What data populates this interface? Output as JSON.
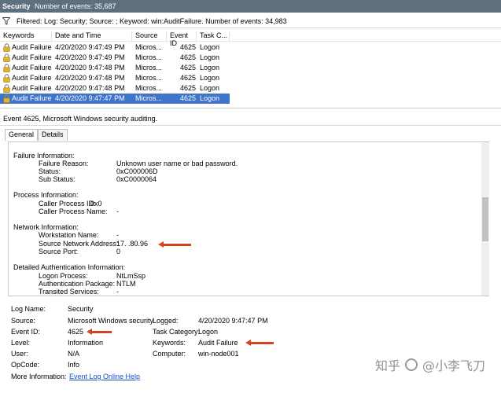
{
  "titlebar": {
    "title": "Security",
    "count_text": "Number of events: 35,687"
  },
  "filter": {
    "text": "Filtered: Log: Security; Source: ; Keyword: win:AuditFailure. Number of events: 34,983"
  },
  "grid": {
    "headers": [
      "Keywords",
      "Date and Time",
      "Source",
      "Event ID",
      "Task C..."
    ],
    "rows": [
      {
        "keyword": "Audit Failure",
        "datetime": "4/20/2020 9:47:49 PM",
        "source": "Micros...",
        "event_id": "4625",
        "task": "Logon"
      },
      {
        "keyword": "Audit Failure",
        "datetime": "4/20/2020 9:47:49 PM",
        "source": "Micros...",
        "event_id": "4625",
        "task": "Logon"
      },
      {
        "keyword": "Audit Failure",
        "datetime": "4/20/2020 9:47:48 PM",
        "source": "Micros...",
        "event_id": "4625",
        "task": "Logon"
      },
      {
        "keyword": "Audit Failure",
        "datetime": "4/20/2020 9:47:48 PM",
        "source": "Micros...",
        "event_id": "4625",
        "task": "Logon"
      },
      {
        "keyword": "Audit Failure",
        "datetime": "4/20/2020 9:47:48 PM",
        "source": "Micros...",
        "event_id": "4625",
        "task": "Logon"
      },
      {
        "keyword": "Audit Failure",
        "datetime": "4/20/2020 9:47:47 PM",
        "source": "Micros...",
        "event_id": "4625",
        "task": "Logon"
      }
    ],
    "selected_index": 5
  },
  "summary": "Event 4625, Microsoft Windows security auditing.",
  "tabs": [
    "General",
    "Details"
  ],
  "details": {
    "failure": {
      "heading": "Failure Information:",
      "reason_label": "Failure Reason:",
      "reason_value": "Unknown user name or bad password.",
      "status_label": "Status:",
      "status_value": "0xC000006D",
      "substatus_label": "Sub Status:",
      "substatus_value": "0xC0000064"
    },
    "process": {
      "heading": "Process Information:",
      "pid_label": "Caller Process ID:",
      "pid_value": "0x0",
      "pname_label": "Caller Process Name:",
      "pname_value": "-"
    },
    "network": {
      "heading": "Network Information:",
      "ws_label": "Workstation Name:",
      "ws_value": "-",
      "addr_label": "Source Network Address:",
      "addr_value": "17.  .80.96",
      "port_label": "Source Port:",
      "port_value": "0"
    },
    "auth": {
      "heading": "Detailed Authentication Information:",
      "lp_label": "Logon Process:",
      "lp_value": "NtLmSsp",
      "ap_label": "Authentication Package:",
      "ap_value": "NTLM",
      "ts_label": "Transited Services:",
      "ts_value": "-"
    }
  },
  "properties": {
    "log_name_label": "Log Name:",
    "log_name_value": "Security",
    "source_label": "Source:",
    "source_value": "Microsoft Windows security",
    "logged_label": "Logged:",
    "logged_value": "4/20/2020 9:47:47 PM",
    "event_id_label": "Event ID:",
    "event_id_value": "4625",
    "task_label": "Task Category:",
    "task_value": "Logon",
    "level_label": "Level:",
    "level_value": "Information",
    "keywords_label": "Keywords:",
    "keywords_value": "Audit Failure",
    "user_label": "User:",
    "user_value": "N/A",
    "computer_label": "Computer:",
    "computer_value": "win-node001",
    "opcode_label": "OpCode:",
    "opcode_value": "Info",
    "more_label": "More Information:",
    "more_link": "Event Log Online Help"
  },
  "watermark": {
    "site": "知乎",
    "handle": "@小李飞刀"
  },
  "colors": {
    "titlebar": "#5e6f7e",
    "selection": "#3f74c9",
    "arrow": "#d4421f",
    "link": "#1a4ec7"
  },
  "icons": {
    "filter": "filter-funnel-icon",
    "row": "lock-icon"
  }
}
